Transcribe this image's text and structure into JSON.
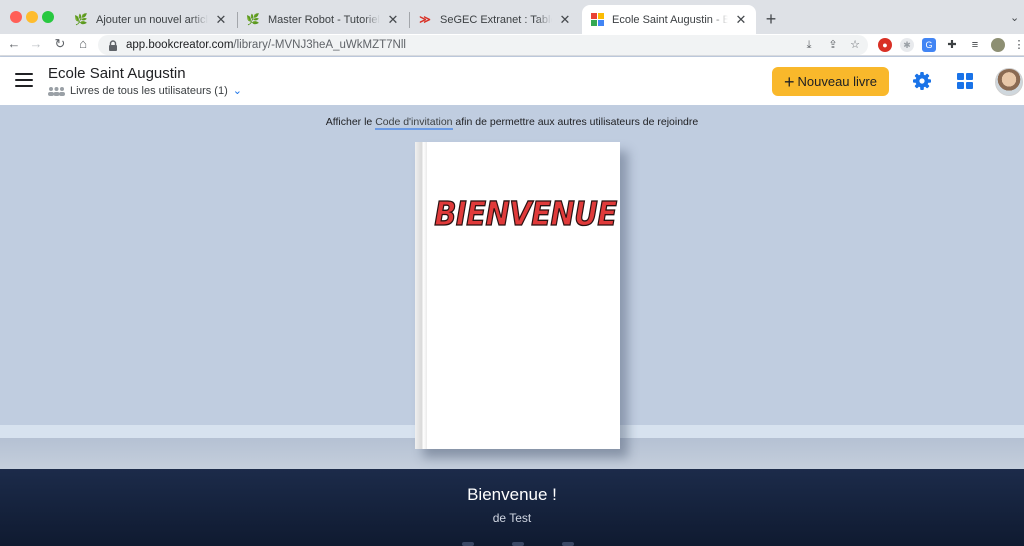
{
  "browser": {
    "tabs": [
      {
        "title": "Ajouter un nouvel article ‹ Master Robot",
        "favicon": "robot-favicon"
      },
      {
        "title": "Master Robot - Tutoriel : Book Creator",
        "favicon": "robot-favicon"
      },
      {
        "title": "SeGEC Extranet : Tableau de bord",
        "favicon": "segec-favicon"
      },
      {
        "title": "Ecole Saint Augustin - Book Creator",
        "favicon": "bookcreator-favicon",
        "active": true
      }
    ],
    "new_tab": "+",
    "tab_menu": "⌄",
    "close": "✕",
    "url_host": "app.bookcreator.com",
    "url_path": "/library/-MVNJ3heA_uWkMZT7Nll"
  },
  "header": {
    "title": "Ecole Saint Augustin",
    "subtitle": "Livres de tous les utilisateurs (1)",
    "new_book_label": "Nouveau livre",
    "new_book_plus": "+",
    "dropdown": "⌄"
  },
  "library": {
    "invite_prefix": "Afficher le",
    "invite_link": "Code d'invitation",
    "invite_suffix": "afin de permettre aux autres utilisateurs de rejoindre",
    "book_cover_title": "BIENVENUE"
  },
  "footer": {
    "book_title": "Bienvenue !",
    "author_line": "de Test"
  },
  "colors": {
    "accent": "#1a73e8",
    "new_book": "#f9b82b",
    "library_bg": "#c0cde0",
    "footer_bg": "#1c2b4a",
    "cover_title": "#e03a3a"
  }
}
